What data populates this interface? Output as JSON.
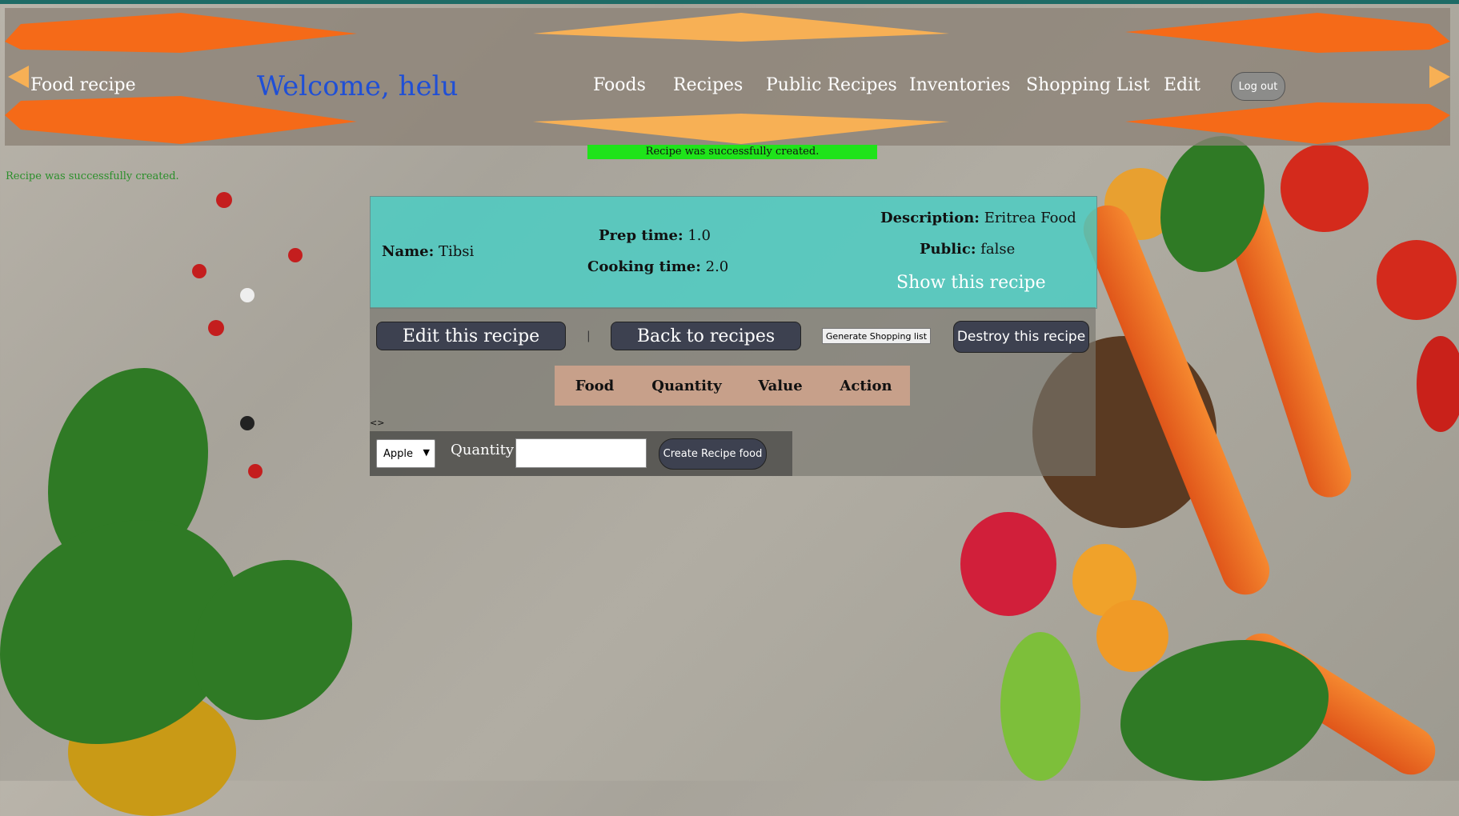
{
  "nav": {
    "brand": "Food recipe",
    "welcome": "Welcome, helu",
    "links": [
      "Foods",
      "Recipes",
      "Public Recipes",
      "Inventories",
      "Shopping List",
      "Edit"
    ],
    "logout": "Log out"
  },
  "flash": {
    "bar": "Recipe was successfully created.",
    "text": "Recipe was successfully created."
  },
  "recipe": {
    "name_label": "Name:",
    "name": "Tibsi",
    "prep_label": "Prep time:",
    "prep": "1.0",
    "cook_label": "Cooking time:",
    "cook": "2.0",
    "desc_label": "Description:",
    "desc": "Eritrea Food",
    "public_label": "Public:",
    "public": "false",
    "show_link": "Show this recipe"
  },
  "actions": {
    "edit": "Edit this recipe",
    "separator": "|",
    "back": "Back to recipes",
    "generate": "Generate Shopping list",
    "destroy": "Destroy this recipe"
  },
  "table": {
    "headers": [
      "Food",
      "Quantity",
      "Value",
      "Action"
    ]
  },
  "angle_text": "<>",
  "form": {
    "food_selected": "Apple",
    "quantity_label": "Quantity",
    "quantity_value": "",
    "submit": "Create Recipe food"
  },
  "colors": {
    "card": "#49cec4",
    "flash": "#1fe31a",
    "welcome": "#1f4fd6",
    "button": "#3d4150",
    "table_header": "#c7a08a"
  }
}
